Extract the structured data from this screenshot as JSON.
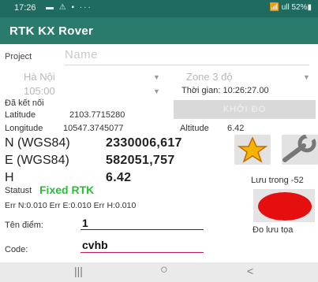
{
  "status_bar": {
    "time": "17:26",
    "icons": "▬ ⚠ ▪ ···",
    "right": "📶 ull 52%▮"
  },
  "app": {
    "title": "RTK KX Rover"
  },
  "project": {
    "label": "Project",
    "placeholder": "Name"
  },
  "dropdowns": {
    "province": "Hà Nội",
    "zone": "Zone 3 độ",
    "meridian": "105:00"
  },
  "time_label": "Thời gian: 10:26:27.00",
  "connection": "Đã kết nối",
  "latitude": {
    "label": "Latitude",
    "value": "2103.7715280"
  },
  "longitude": {
    "label": "Longitude",
    "value": "10547.3745077"
  },
  "altitude": {
    "label": "Altitude",
    "value": "6.42"
  },
  "start_button": "KHỞI ĐO",
  "coords": {
    "n_label": "N (WGS84)",
    "n_value": "2330006,617",
    "e_label": "E (WGS84)",
    "e_value": "582051,757",
    "h_label": "H",
    "h_value": "6.42"
  },
  "save_status": "Lưu trong -52",
  "status": {
    "label": "Statust",
    "value": "Fixed RTK"
  },
  "errors": "Err N:0.010  Err E:0.010  Err H:0.010",
  "point_name": {
    "label": "Tên điểm:",
    "value": "1"
  },
  "code": {
    "label": "Code:",
    "value": "cvhb"
  },
  "record_caption": "Đo lưu tọa",
  "nav": {
    "recent": "|||",
    "home": "○",
    "back": "<"
  },
  "colors": {
    "app_bar": "#2b7b6d",
    "fixed": "#22c332",
    "record": "#e60f0f"
  }
}
